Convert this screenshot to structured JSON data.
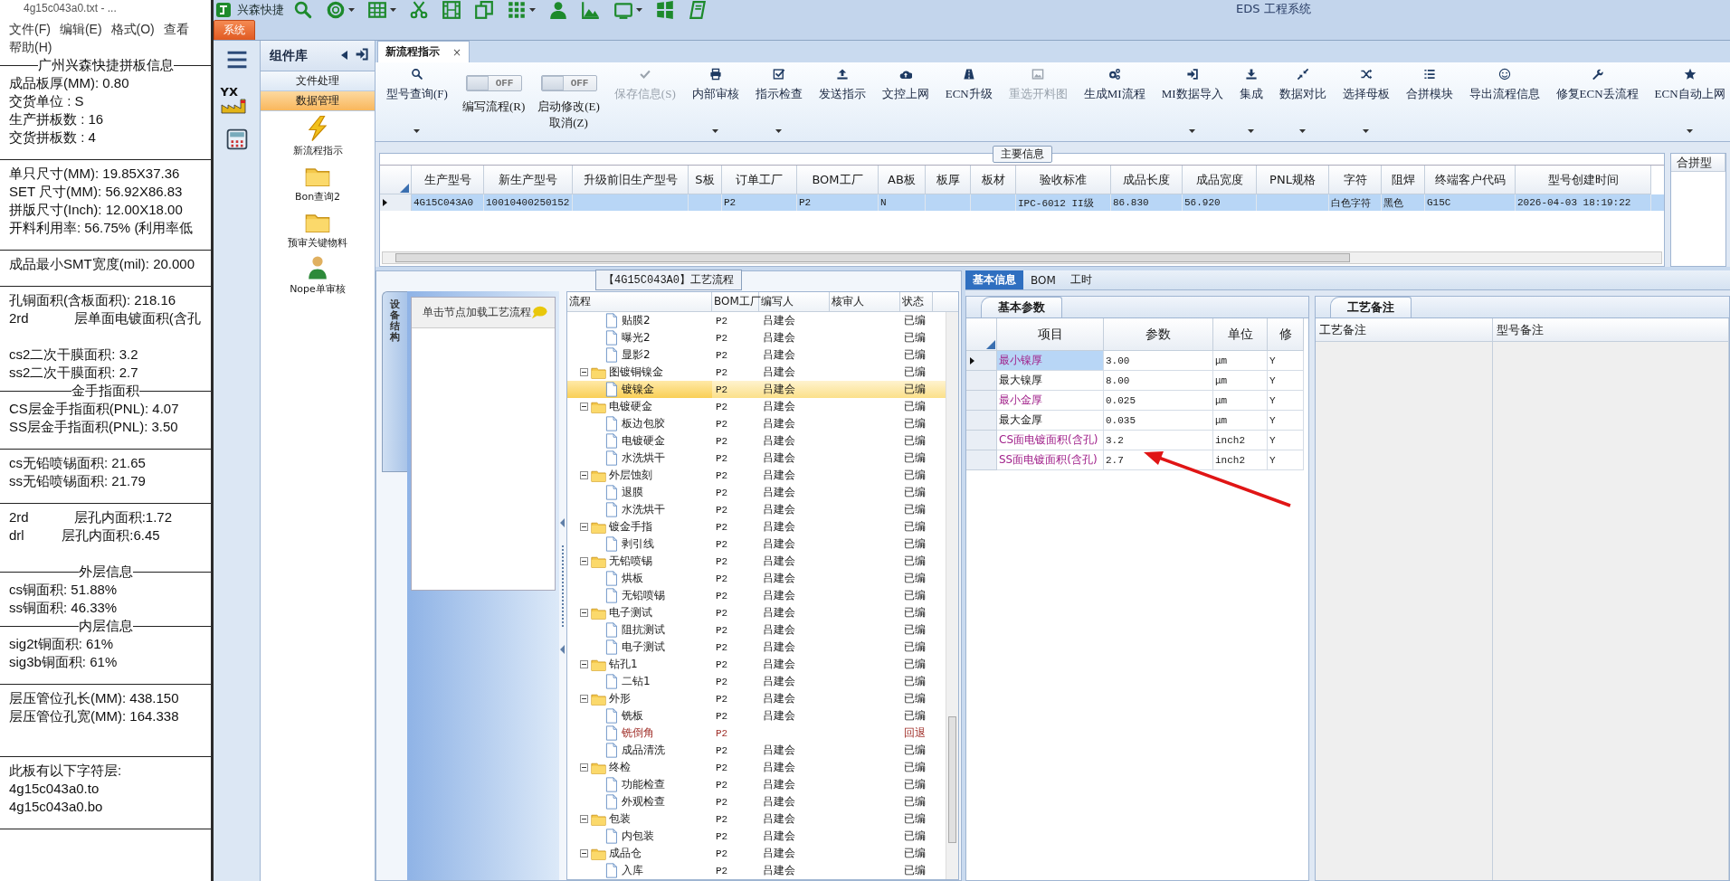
{
  "notepad": {
    "title": "4g15c043a0.txt - ...",
    "menu": [
      "文件(F)",
      "编辑(E)",
      "格式(O)",
      "查看",
      "帮助(H)"
    ],
    "lines": [
      {
        "kind": "heading",
        "text": "广州兴森快捷拼板信息"
      },
      {
        "kind": "text",
        "text": "成品板厚(MM): 0.80"
      },
      {
        "kind": "text",
        "text": "交货单位 : S"
      },
      {
        "kind": "text",
        "text": "生产拼板数 : 16"
      },
      {
        "kind": "text",
        "text": "交货拼板数 : 4"
      },
      {
        "kind": "rule"
      },
      {
        "kind": "text",
        "text": "单只尺寸(MM): 19.85X37.36"
      },
      {
        "kind": "text",
        "text": "SET 尺寸(MM): 56.92X86.83"
      },
      {
        "kind": "text",
        "text": "拼版尺寸(Inch): 12.00X18.00"
      },
      {
        "kind": "text",
        "text": "开料利用率: 56.75% (利用率低"
      },
      {
        "kind": "rule"
      },
      {
        "kind": "text",
        "text": "成品最小SMT宽度(mil): 20.000"
      },
      {
        "kind": "rule"
      },
      {
        "kind": "text",
        "text": "孔铜面积(含板面积): 218.16"
      },
      {
        "kind": "text",
        "text": "2rd            层单面电镀面积(含孔"
      },
      {
        "kind": "gap"
      },
      {
        "kind": "text",
        "text": "cs2二次干膜面积: 3.2"
      },
      {
        "kind": "text",
        "text": "ss2二次干膜面积: 2.7"
      },
      {
        "kind": "heading",
        "text": "金手指面积"
      },
      {
        "kind": "text",
        "text": "CS层金手指面积(PNL): 4.07"
      },
      {
        "kind": "text",
        "text": "SS层金手指面积(PNL): 3.50"
      },
      {
        "kind": "rule"
      },
      {
        "kind": "text",
        "text": "cs无铅喷锡面积: 21.65"
      },
      {
        "kind": "text",
        "text": "ss无铅喷锡面积: 21.79"
      },
      {
        "kind": "rule"
      },
      {
        "kind": "text",
        "text": "2rd            层孔内面积:1.72"
      },
      {
        "kind": "text",
        "text": "drl          层孔内面积:6.45"
      },
      {
        "kind": "gap"
      },
      {
        "kind": "heading",
        "text": "外层信息"
      },
      {
        "kind": "text",
        "text": "cs铜面积: 51.88%"
      },
      {
        "kind": "text",
        "text": "ss铜面积: 46.33%"
      },
      {
        "kind": "heading",
        "text": "内层信息"
      },
      {
        "kind": "text",
        "text": "sig2t铜面积: 61%"
      },
      {
        "kind": "text",
        "text": "sig3b铜面积: 61%"
      },
      {
        "kind": "rule"
      },
      {
        "kind": "text",
        "text": "层压管位孔长(MM): 438.150"
      },
      {
        "kind": "text",
        "text": "层压管位孔宽(MM): 164.338"
      },
      {
        "kind": "gap"
      },
      {
        "kind": "rule"
      },
      {
        "kind": "text",
        "text": "此板有以下字符层:"
      },
      {
        "kind": "text",
        "text": "4g15c043a0.to"
      },
      {
        "kind": "text",
        "text": "4g15c043a0.bo"
      },
      {
        "kind": "rule"
      }
    ]
  },
  "app": {
    "brand": "兴森快捷",
    "title": "EDS 工程系统",
    "system_tab": "系统",
    "quick_tools": [
      {
        "kind": "search",
        "dropdown": false
      },
      {
        "kind": "lifebuoy",
        "dropdown": true
      },
      {
        "kind": "table",
        "dropdown": true
      },
      {
        "kind": "scissors",
        "dropdown": false
      },
      {
        "kind": "film",
        "dropdown": false
      },
      {
        "kind": "copy",
        "dropdown": false
      },
      {
        "kind": "grid",
        "dropdown": true
      },
      {
        "kind": "person",
        "dropdown": false
      },
      {
        "kind": "picture",
        "dropdown": false
      },
      {
        "kind": "tablet",
        "dropdown": true
      },
      {
        "kind": "windows",
        "dropdown": false
      },
      {
        "kind": "book",
        "dropdown": false
      }
    ]
  },
  "nav": [
    {
      "kind": "menu"
    },
    {
      "kind": "factory",
      "text": "YX"
    },
    {
      "kind": "calculator"
    }
  ],
  "component_library": {
    "title": "组件库",
    "groups": [
      {
        "label": "文件处理",
        "selected": false
      },
      {
        "label": "数据管理",
        "selected": true
      }
    ],
    "items": [
      {
        "kind": "lightning",
        "label": "新流程指示"
      },
      {
        "kind": "folder",
        "label": "Bon查询2"
      },
      {
        "kind": "folder",
        "label": "预审关键物料"
      },
      {
        "kind": "person",
        "label": "Nope单审核"
      }
    ]
  },
  "doc_tabs": [
    {
      "label": "新流程指示",
      "selected": true,
      "close": "×"
    }
  ],
  "toolbar": [
    {
      "kind": "button",
      "label": "型号查询(F)",
      "disabled": false,
      "dropdown": true
    },
    {
      "kind": "toggle",
      "label": "编写流程(R)",
      "on": false,
      "state_text": "OFF"
    },
    {
      "kind": "toggle",
      "label": "启动修改(E)\n取消(Z)",
      "on": false,
      "state_text": "OFF"
    },
    {
      "kind": "button",
      "label": "保存信息(S)",
      "disabled": true,
      "dropdown": false
    },
    {
      "kind": "button",
      "label": "内部审核",
      "disabled": false,
      "dropdown": true
    },
    {
      "kind": "button",
      "label": "指示检查",
      "disabled": false,
      "dropdown": true
    },
    {
      "kind": "button",
      "label": "发送指示",
      "disabled": false,
      "dropdown": false
    },
    {
      "kind": "button",
      "label": "文控上网",
      "disabled": false,
      "dropdown": false
    },
    {
      "kind": "button",
      "label": "ECN升级",
      "disabled": false,
      "dropdown": false
    },
    {
      "kind": "button",
      "label": "重选开料图",
      "disabled": true,
      "dropdown": false
    },
    {
      "kind": "button",
      "label": "生成MI流程",
      "disabled": false,
      "dropdown": false
    },
    {
      "kind": "button",
      "label": "MI数据导入",
      "disabled": false,
      "dropdown": true
    },
    {
      "kind": "button",
      "label": "集成",
      "disabled": false,
      "dropdown": true
    },
    {
      "kind": "button",
      "label": "数据对比",
      "disabled": false,
      "dropdown": true
    },
    {
      "kind": "button",
      "label": "选择母板",
      "disabled": false,
      "dropdown": true
    },
    {
      "kind": "button",
      "label": "合拼模块",
      "disabled": false,
      "dropdown": false
    },
    {
      "kind": "button",
      "label": "导出流程信息",
      "disabled": false,
      "dropdown": false
    },
    {
      "kind": "button",
      "label": "修复ECN丢流程",
      "disabled": false,
      "dropdown": false
    },
    {
      "kind": "button",
      "label": "ECN自动上网",
      "disabled": false,
      "dropdown": true
    }
  ],
  "main_info": {
    "title": "主要信息",
    "columns": [
      "生产型号",
      "新生产型号",
      "升级前旧生产型号",
      "S板",
      "订单工厂",
      "BOM工厂",
      "AB板",
      "板厚",
      "板材",
      "验收标准",
      "成品长度",
      "成品宽度",
      "PNL规格",
      "字符",
      "阻焊",
      "终端客户代码",
      "型号创建时间"
    ],
    "rows": [
      {
        "selected": true,
        "cells": [
          "4G15C043A0",
          "10010400250152",
          null,
          null,
          "P2",
          "P2",
          "N",
          null,
          null,
          "IPC-6012 II级",
          "86.830",
          "56.920",
          null,
          "白色字符",
          "黑色",
          "G15C",
          "2026-04-03 18:19:22"
        ]
      }
    ],
    "side_column": "合拼型"
  },
  "flow": {
    "title": "【4G15C043A0】工艺流程",
    "side_tab": "设备结构",
    "hint": "单击节点加载工艺流程",
    "columns": [
      "流程",
      "BOM工厂",
      "编写人",
      "核审人",
      "状态"
    ],
    "tree": [
      {
        "children": [
          {
            "label": "贴膜2",
            "bom": "P2",
            "writer": "吕建会",
            "status": "已编",
            "selected": false,
            "returned": false
          },
          {
            "label": "曝光2",
            "bom": "P2",
            "writer": "吕建会",
            "status": "已编",
            "selected": false,
            "returned": false
          },
          {
            "label": "显影2",
            "bom": "P2",
            "writer": "吕建会",
            "status": "已编",
            "selected": false,
            "returned": false
          }
        ]
      },
      {
        "label": "图镀铜镍金",
        "bom": "P2",
        "writer": "吕建会",
        "status": "已编",
        "selected": false,
        "returned": false,
        "expanded": true,
        "children": [
          {
            "label": "镀镍金",
            "bom": "P2",
            "writer": "吕建会",
            "status": "已编",
            "selected": true,
            "returned": false
          }
        ]
      },
      {
        "label": "电镀硬金",
        "bom": "P2",
        "writer": "吕建会",
        "status": "已编",
        "selected": false,
        "returned": false,
        "expanded": true,
        "children": [
          {
            "label": "板边包胶",
            "bom": "P2",
            "writer": "吕建会",
            "status": "已编",
            "selected": false,
            "returned": false
          },
          {
            "label": "电镀硬金",
            "bom": "P2",
            "writer": "吕建会",
            "status": "已编",
            "selected": false,
            "returned": false
          },
          {
            "label": "水洗烘干",
            "bom": "P2",
            "writer": "吕建会",
            "status": "已编",
            "selected": false,
            "returned": false
          }
        ]
      },
      {
        "label": "外层蚀刻",
        "bom": "P2",
        "writer": "吕建会",
        "status": "已编",
        "selected": false,
        "returned": false,
        "expanded": true,
        "children": [
          {
            "label": "退膜",
            "bom": "P2",
            "writer": "吕建会",
            "status": "已编",
            "selected": false,
            "returned": false
          },
          {
            "label": "水洗烘干",
            "bom": "P2",
            "writer": "吕建会",
            "status": "已编",
            "selected": false,
            "returned": false
          }
        ]
      },
      {
        "label": "镀金手指",
        "bom": "P2",
        "writer": "吕建会",
        "status": "已编",
        "selected": false,
        "returned": false,
        "expanded": true,
        "children": [
          {
            "label": "剥引线",
            "bom": "P2",
            "writer": "吕建会",
            "status": "已编",
            "selected": false,
            "returned": false
          }
        ]
      },
      {
        "label": "无铅喷锡",
        "bom": "P2",
        "writer": "吕建会",
        "status": "已编",
        "selected": false,
        "returned": false,
        "expanded": true,
        "children": [
          {
            "label": "烘板",
            "bom": "P2",
            "writer": "吕建会",
            "status": "已编",
            "selected": false,
            "returned": false
          },
          {
            "label": "无铅喷锡",
            "bom": "P2",
            "writer": "吕建会",
            "status": "已编",
            "selected": false,
            "returned": false
          }
        ]
      },
      {
        "label": "电子测试",
        "bom": "P2",
        "writer": "吕建会",
        "status": "已编",
        "selected": false,
        "returned": false,
        "expanded": true,
        "children": [
          {
            "label": "阻抗测试",
            "bom": "P2",
            "writer": "吕建会",
            "status": "已编",
            "selected": false,
            "returned": false
          },
          {
            "label": "电子测试",
            "bom": "P2",
            "writer": "吕建会",
            "status": "已编",
            "selected": false,
            "returned": false
          }
        ]
      },
      {
        "label": "钻孔1",
        "bom": "P2",
        "writer": "吕建会",
        "status": "已编",
        "selected": false,
        "returned": false,
        "expanded": true,
        "children": [
          {
            "label": "二钻1",
            "bom": "P2",
            "writer": "吕建会",
            "status": "已编",
            "selected": false,
            "returned": false
          }
        ]
      },
      {
        "label": "外形",
        "bom": "P2",
        "writer": "吕建会",
        "status": "已编",
        "selected": false,
        "returned": false,
        "expanded": true,
        "children": [
          {
            "label": "铣板",
            "bom": "P2",
            "writer": "吕建会",
            "status": "已编",
            "selected": false,
            "returned": false
          },
          {
            "label": "铣倒角",
            "bom": "P2",
            "status": "回退",
            "selected": false,
            "returned": true
          },
          {
            "label": "成品清洗",
            "bom": "P2",
            "writer": "吕建会",
            "status": "已编",
            "selected": false,
            "returned": false
          }
        ]
      },
      {
        "label": "终检",
        "bom": "P2",
        "writer": "吕建会",
        "status": "已编",
        "selected": false,
        "returned": false,
        "expanded": true,
        "children": [
          {
            "label": "功能检查",
            "bom": "P2",
            "writer": "吕建会",
            "status": "已编",
            "selected": false,
            "returned": false
          },
          {
            "label": "外观检查",
            "bom": "P2",
            "writer": "吕建会",
            "status": "已编",
            "selected": false,
            "returned": false
          }
        ]
      },
      {
        "label": "包装",
        "bom": "P2",
        "writer": "吕建会",
        "status": "已编",
        "selected": false,
        "returned": false,
        "expanded": true,
        "children": [
          {
            "label": "内包装",
            "bom": "P2",
            "writer": "吕建会",
            "status": "已编",
            "selected": false,
            "returned": false
          }
        ]
      },
      {
        "label": "成品仓",
        "bom": "P2",
        "writer": "吕建会",
        "status": "已编",
        "selected": false,
        "returned": false,
        "expanded": true,
        "children": [
          {
            "label": "入库",
            "bom": "P2",
            "writer": "吕建会",
            "status": "已编",
            "selected": false,
            "returned": false
          }
        ]
      }
    ]
  },
  "detail_tabs": [
    {
      "label": "基本信息",
      "selected": true
    },
    {
      "label": "BOM",
      "selected": false
    },
    {
      "label": "工时",
      "selected": false
    }
  ],
  "params": {
    "tab": "基本参数",
    "columns": [
      "项目",
      "参数",
      "单位",
      "修"
    ],
    "rows": [
      {
        "item": "最小镍厚",
        "value": "3.00",
        "unit": "μm",
        "modify": "Y",
        "highlighted": true,
        "selected": true
      },
      {
        "item": "最大镍厚",
        "value": "8.00",
        "unit": "μm",
        "modify": "Y",
        "highlighted": false,
        "selected": false
      },
      {
        "item": "最小金厚",
        "value": "0.025",
        "unit": "μm",
        "modify": "Y",
        "highlighted": true,
        "selected": false
      },
      {
        "item": "最大金厚",
        "value": "0.035",
        "unit": "μm",
        "modify": "Y",
        "highlighted": false,
        "selected": false
      },
      {
        "item": "CS面电镀面积(含孔)",
        "value": "3.2",
        "unit": "inch2",
        "modify": "Y",
        "highlighted": true,
        "selected": false
      },
      {
        "item": "SS面电镀面积(含孔)",
        "value": "2.7",
        "unit": "inch2",
        "modify": "Y",
        "highlighted": true,
        "selected": false
      }
    ]
  },
  "remarks": {
    "tab": "工艺备注",
    "columns": [
      "工艺备注",
      "型号备注"
    ]
  }
}
